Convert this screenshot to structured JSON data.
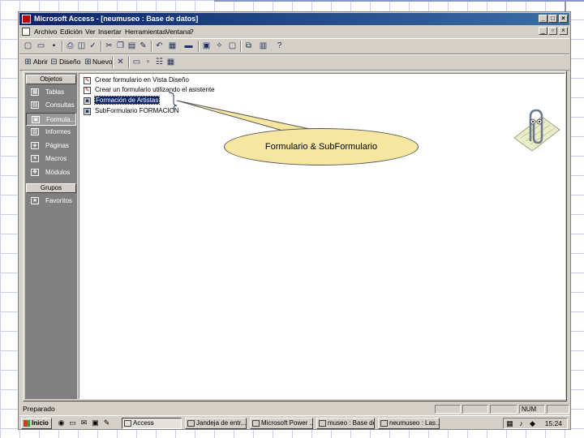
{
  "window": {
    "title": "Microsoft Access - [neumuseo : Base de datos]"
  },
  "menubar": {
    "items": [
      "Archivo",
      "Edición",
      "Ver",
      "Insertar",
      "Herramientas",
      "Ventana",
      "?"
    ]
  },
  "db_toolbar": {
    "open_label": "Abrir",
    "design_label": "Diseño",
    "new_label": "Nuevo"
  },
  "objects_bar": {
    "header": "Objetos",
    "items": [
      {
        "label": "Tablas",
        "icon": "table-icon"
      },
      {
        "label": "Consultas",
        "icon": "query-icon"
      },
      {
        "label": "Formula...",
        "icon": "form-icon"
      },
      {
        "label": "Informes",
        "icon": "report-icon"
      },
      {
        "label": "Páginas",
        "icon": "page-icon"
      },
      {
        "label": "Macros",
        "icon": "macro-icon"
      },
      {
        "label": "Módulos",
        "icon": "module-icon"
      }
    ],
    "groups_header": "Grupos",
    "favorites": "Favoritos"
  },
  "list": {
    "items": [
      {
        "label": "Crear formulario en Vista Diseño",
        "icon": "wizard-icon"
      },
      {
        "label": "Crear un formulario utilizando el asistente",
        "icon": "wizard-icon"
      },
      {
        "label": "Formación de Artistas",
        "icon": "form-icon"
      },
      {
        "label": "SubFormulario FORMACION",
        "icon": "form-icon"
      }
    ]
  },
  "callout": {
    "text": "Formulario & SubFormulario"
  },
  "statusbar": {
    "text": "Preparado",
    "num": "NUM"
  },
  "taskbar": {
    "start": "Inicio",
    "tasks": [
      "Access",
      "Jandeja de entr...",
      "Microsoft Power ...",
      "museo : Base de...",
      "neumuseo : Las..."
    ],
    "clock": "15:24"
  },
  "colors": {
    "titlebar": "#0a246a",
    "window_face": "#d4d0c8",
    "objects_bar": "#808080",
    "callout_fill": "#f5e6a0"
  }
}
